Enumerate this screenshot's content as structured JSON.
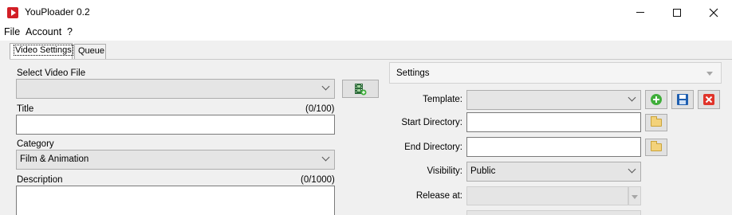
{
  "window": {
    "title": "YouPloader 0.2"
  },
  "menu": {
    "file": "File",
    "account": "Account",
    "help": "?"
  },
  "tabs": {
    "video_settings": "Video Settings",
    "queue": "Queue"
  },
  "left": {
    "select_video_label": "Select Video File",
    "select_video_value": "",
    "title_label": "Title",
    "title_count": "(0/100)",
    "title_value": "",
    "category_label": "Category",
    "category_value": "Film & Animation",
    "description_label": "Description",
    "description_count": "(0/1000)"
  },
  "settings": {
    "header": "Settings",
    "template_label": "Template:",
    "template_value": "",
    "start_dir_label": "Start Directory:",
    "start_dir_value": "",
    "end_dir_label": "End Directory:",
    "end_dir_value": "",
    "visibility_label": "Visibility:",
    "visibility_value": "Public",
    "release_label": "Release at:",
    "release_value": ""
  },
  "icons": {
    "add": "add-icon",
    "save": "save-icon",
    "delete": "delete-icon",
    "folder": "folder-icon",
    "film": "film-icon"
  },
  "colors": {
    "add": "#3fae3a",
    "save": "#1f5fb0",
    "delete": "#e0342a",
    "titlebar_icon": "#d21f26"
  }
}
